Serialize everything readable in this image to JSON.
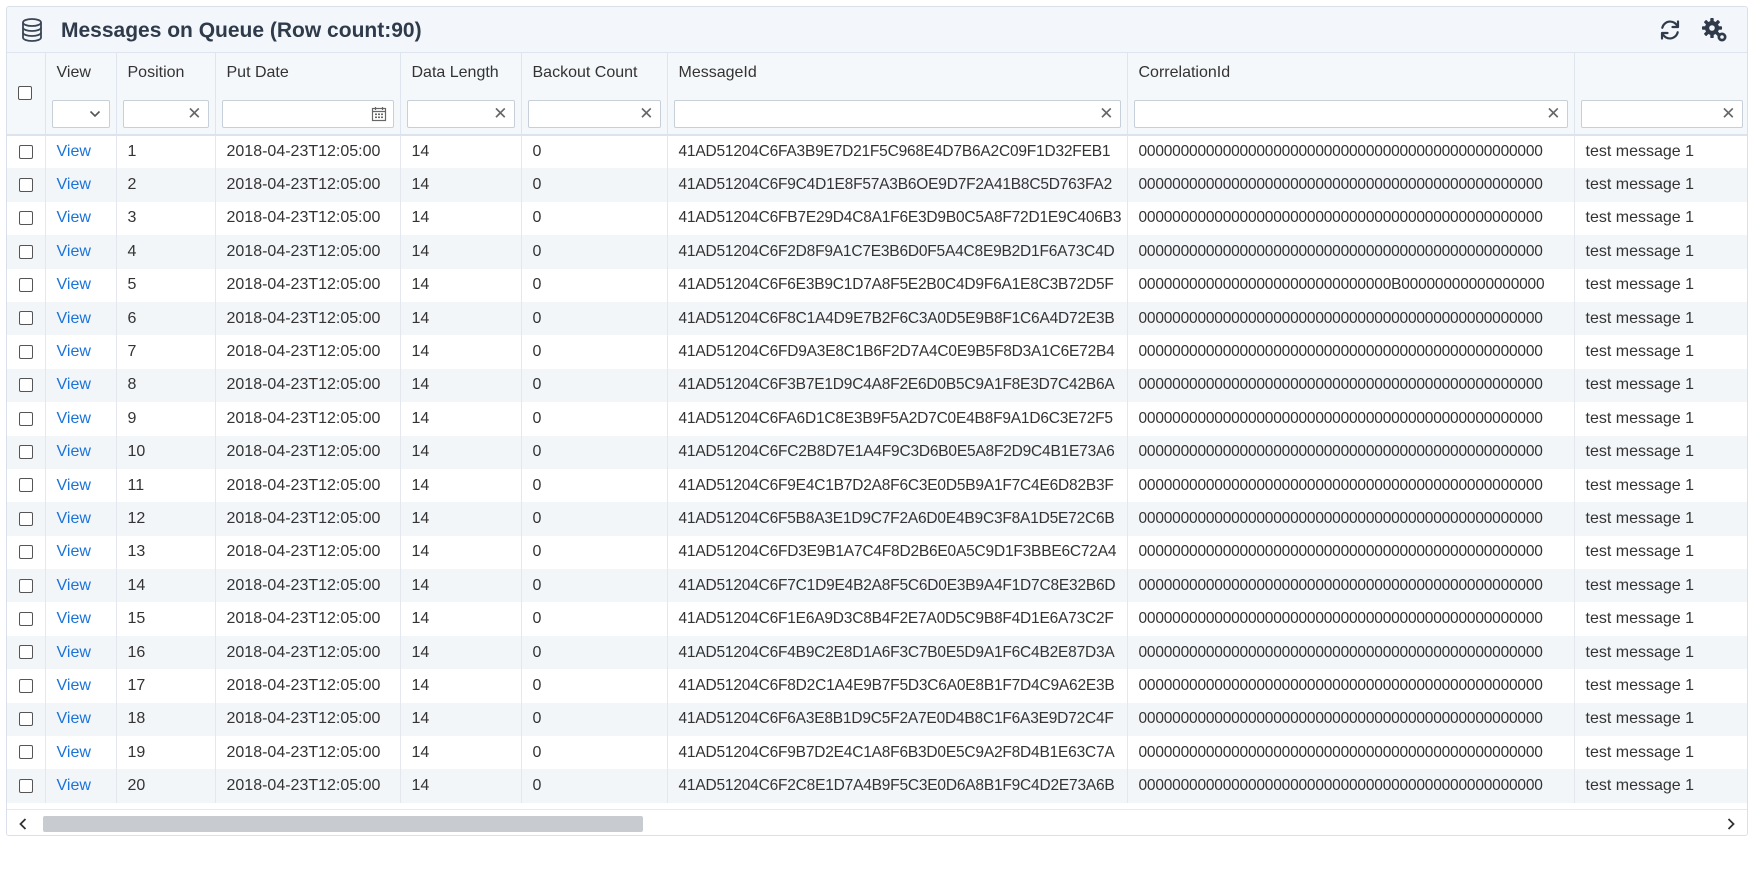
{
  "window": {
    "title": "Messages on Queue (Row count:90)",
    "icons": {
      "database": "database-icon",
      "refresh": "refresh-icon",
      "settings": "settings-gear-icon"
    }
  },
  "grid": {
    "columns": [
      "View",
      "Position",
      "Put Date",
      "Data Length",
      "Backout Count",
      "MessageId",
      "CorrelationId",
      ""
    ],
    "filters": {
      "view": "",
      "position": "",
      "put_date": "",
      "data_length": "",
      "backout_count": "",
      "message_id": "",
      "correlation_id": "",
      "extra": ""
    },
    "rows": [
      {
        "view": "View",
        "position": "1",
        "put_date": "2018-04-23T12:05:00",
        "data_length": "14",
        "backout_count": "0",
        "message_id": "41AD51204C6FA3B9E7D21F5C968E4D7B6A2C09F1D32FEB1",
        "correlation_id": "000000000000000000000000000000000000000000000000",
        "message": "test message 1"
      },
      {
        "view": "View",
        "position": "2",
        "put_date": "2018-04-23T12:05:00",
        "data_length": "14",
        "backout_count": "0",
        "message_id": "41AD51204C6F9C4D1E8F57A3B6OE9D7F2A41B8C5D763FA2",
        "correlation_id": "000000000000000000000000000000000000000000000000",
        "message": "test message 1"
      },
      {
        "view": "View",
        "position": "3",
        "put_date": "2018-04-23T12:05:00",
        "data_length": "14",
        "backout_count": "0",
        "message_id": "41AD51204C6FB7E29D4C8A1F6E3D9B0C5A8F72D1E9C406B3",
        "correlation_id": "000000000000000000000000000000000000000000000000",
        "message": "test message 1"
      },
      {
        "view": "View",
        "position": "4",
        "put_date": "2018-04-23T12:05:00",
        "data_length": "14",
        "backout_count": "0",
        "message_id": "41AD51204C6F2D8F9A1C7E3B6D0F5A4C8E9B2D1F6A73C4D",
        "correlation_id": "000000000000000000000000000000000000000000000000",
        "message": "test message 1"
      },
      {
        "view": "View",
        "position": "5",
        "put_date": "2018-04-23T12:05:00",
        "data_length": "14",
        "backout_count": "0",
        "message_id": "41AD51204C6F6E3B9C1D7A8F5E2B0C4D9F6A1E8C3B72D5F",
        "correlation_id": "000000000000000000000000000000B00000000000000000",
        "message": "test message 1"
      },
      {
        "view": "View",
        "position": "6",
        "put_date": "2018-04-23T12:05:00",
        "data_length": "14",
        "backout_count": "0",
        "message_id": "41AD51204C6F8C1A4D9E7B2F6C3A0D5E9B8F1C6A4D72E3B",
        "correlation_id": "000000000000000000000000000000000000000000000000",
        "message": "test message 1"
      },
      {
        "view": "View",
        "position": "7",
        "put_date": "2018-04-23T12:05:00",
        "data_length": "14",
        "backout_count": "0",
        "message_id": "41AD51204C6FD9A3E8C1B6F2D7A4C0E9B5F8D3A1C6E72B4",
        "correlation_id": "000000000000000000000000000000000000000000000000",
        "message": "test message 1"
      },
      {
        "view": "View",
        "position": "8",
        "put_date": "2018-04-23T12:05:00",
        "data_length": "14",
        "backout_count": "0",
        "message_id": "41AD51204C6F3B7E1D9C4A8F2E6D0B5C9A1F8E3D7C42B6A",
        "correlation_id": "000000000000000000000000000000000000000000000000",
        "message": "test message 1"
      },
      {
        "view": "View",
        "position": "9",
        "put_date": "2018-04-23T12:05:00",
        "data_length": "14",
        "backout_count": "0",
        "message_id": "41AD51204C6FA6D1C8E3B9F5A2D7C0E4B8F9A1D6C3E72F5",
        "correlation_id": "000000000000000000000000000000000000000000000000",
        "message": "test message 1"
      },
      {
        "view": "View",
        "position": "10",
        "put_date": "2018-04-23T12:05:00",
        "data_length": "14",
        "backout_count": "0",
        "message_id": "41AD51204C6FC2B8D7E1A4F9C3D6B0E5A8F2D9C4B1E73A6",
        "correlation_id": "000000000000000000000000000000000000000000000000",
        "message": "test message 1"
      },
      {
        "view": "View",
        "position": "11",
        "put_date": "2018-04-23T12:05:00",
        "data_length": "14",
        "backout_count": "0",
        "message_id": "41AD51204C6F9E4C1B7D2A8F6C3E0D5B9A1F7C4E6D82B3F",
        "correlation_id": "000000000000000000000000000000000000000000000000",
        "message": "test message 1"
      },
      {
        "view": "View",
        "position": "12",
        "put_date": "2018-04-23T12:05:00",
        "data_length": "14",
        "backout_count": "0",
        "message_id": "41AD51204C6F5B8A3E1D9C7F2A6D0E4B9C3F8A1D5E72C6B",
        "correlation_id": "000000000000000000000000000000000000000000000000",
        "message": "test message 1"
      },
      {
        "view": "View",
        "position": "13",
        "put_date": "2018-04-23T12:05:00",
        "data_length": "14",
        "backout_count": "0",
        "message_id": "41AD51204C6FD3E9B1A7C4F8D2B6E0A5C9D1F3BBE6C72A4",
        "correlation_id": "000000000000000000000000000000000000000000000000",
        "message": "test message 1"
      },
      {
        "view": "View",
        "position": "14",
        "put_date": "2018-04-23T12:05:00",
        "data_length": "14",
        "backout_count": "0",
        "message_id": "41AD51204C6F7C1D9E4B2A8F5C6D0E3B9A4F1D7C8E32B6D",
        "correlation_id": "000000000000000000000000000000000000000000000000",
        "message": "test message 1"
      },
      {
        "view": "View",
        "position": "15",
        "put_date": "2018-04-23T12:05:00",
        "data_length": "14",
        "backout_count": "0",
        "message_id": "41AD51204C6F1E6A9D3C8B4F2E7A0D5C9B8F4D1E6A73C2F",
        "correlation_id": "000000000000000000000000000000000000000000000000",
        "message": "test message 1"
      },
      {
        "view": "View",
        "position": "16",
        "put_date": "2018-04-23T12:05:00",
        "data_length": "14",
        "backout_count": "0",
        "message_id": "41AD51204C6F4B9C2E8D1A6F3C7B0E5D9A1F6C4B2E87D3A",
        "correlation_id": "000000000000000000000000000000000000000000000000",
        "message": "test message 1"
      },
      {
        "view": "View",
        "position": "17",
        "put_date": "2018-04-23T12:05:00",
        "data_length": "14",
        "backout_count": "0",
        "message_id": "41AD51204C6F8D2C1A4E9B7F5D3C6A0E8B1F7D4C9A62E3B",
        "correlation_id": "000000000000000000000000000000000000000000000000",
        "message": "test message 1"
      },
      {
        "view": "View",
        "position": "18",
        "put_date": "2018-04-23T12:05:00",
        "data_length": "14",
        "backout_count": "0",
        "message_id": "41AD51204C6F6A3E8B1D9C5F2A7E0D4B8C1F6A3E9D72C4F",
        "correlation_id": "000000000000000000000000000000000000000000000000",
        "message": "test message 1"
      },
      {
        "view": "View",
        "position": "19",
        "put_date": "2018-04-23T12:05:00",
        "data_length": "14",
        "backout_count": "0",
        "message_id": "41AD51204C6F9B7D2E4C1A8F6B3D0E5C9A2F8D4B1E63C7A",
        "correlation_id": "000000000000000000000000000000000000000000000000",
        "message": "test message 1"
      },
      {
        "view": "View",
        "position": "20",
        "put_date": "2018-04-23T12:05:00",
        "data_length": "14",
        "backout_count": "0",
        "message_id": "41AD51204C6F2C8E1D7A4B9F5C3E0D6A8B1F9C4D2E73A6B",
        "correlation_id": "000000000000000000000000000000000000000000000000",
        "message": "test message 1"
      }
    ]
  },
  "colors": {
    "link": "#1a73d9",
    "header_bg": "#f5f8fb",
    "row_alt": "#f3f6f9",
    "scroll_thumb": "#c8ccd1"
  }
}
